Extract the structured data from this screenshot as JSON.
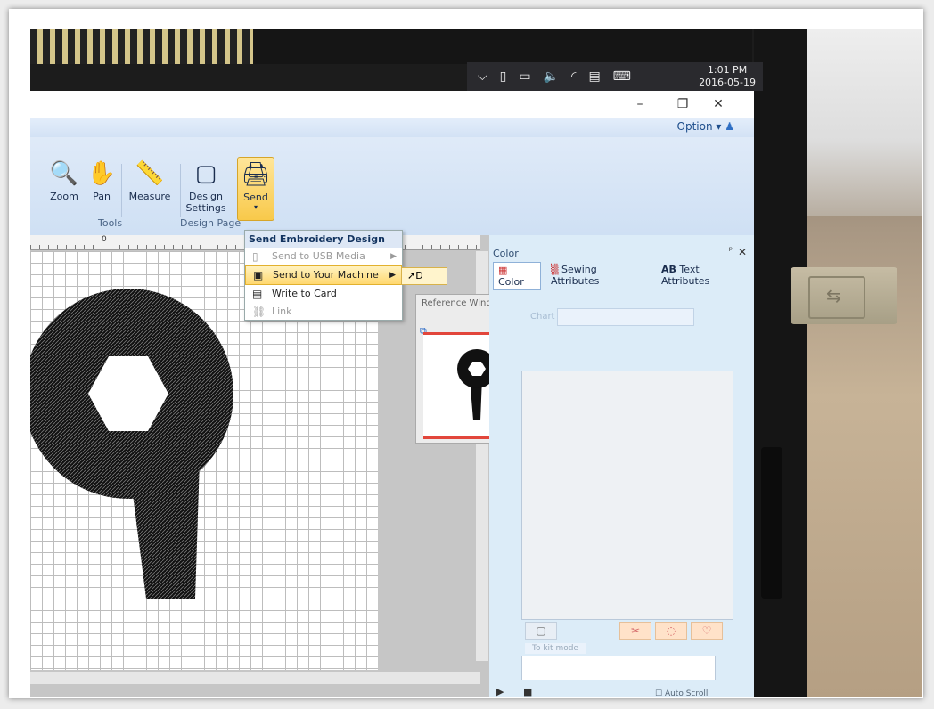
{
  "taskbar": {
    "tray_icons": [
      "chevron-up-icon",
      "usb-icon",
      "battery-icon",
      "volume-icon",
      "wifi-icon",
      "notification-icon",
      "keyboard-icon"
    ],
    "time": "1:01 PM",
    "date": "2016-05-19"
  },
  "window": {
    "minimize": "–",
    "maximize": "❐",
    "close": "✕",
    "option_label": "Option"
  },
  "ribbon": {
    "buttons": {
      "zoom": "Zoom",
      "pan": "Pan",
      "measure": "Measure",
      "design_settings_line1": "Design",
      "design_settings_line2": "Settings",
      "send": "Send"
    },
    "groups": {
      "tools": "Tools",
      "design_page": "Design Page"
    }
  },
  "send_menu": {
    "title": "Send Embroidery Design",
    "items": [
      {
        "label": "Send to USB Media",
        "enabled": false
      },
      {
        "label": "Send to Your Machine",
        "enabled": true,
        "highlighted": true
      },
      {
        "label": "Write to Card",
        "enabled": true
      },
      {
        "label": "Link",
        "enabled": false
      }
    ],
    "submenu_label": "D"
  },
  "ruler": {
    "label_0": "0"
  },
  "reference_window": {
    "title": "Reference Window"
  },
  "color_panel": {
    "title": "Color",
    "close": "✕",
    "pin": "ᵖ",
    "tabs": [
      {
        "label": "Color",
        "active": true
      },
      {
        "label": "Sewing Attributes",
        "active": false
      },
      {
        "label": "Text Attributes",
        "active": false
      }
    ],
    "chart_label": "Chart",
    "mode_label": "To kit mode",
    "auto_scroll": "Auto Scroll"
  },
  "colors": {
    "accent_yellow": "#f8c94a",
    "menu_highlight": "#ffd870",
    "reference_red": "#e2463b",
    "ribbon_blue": "#cfe0f4",
    "panel_blue": "#dcecf8"
  }
}
